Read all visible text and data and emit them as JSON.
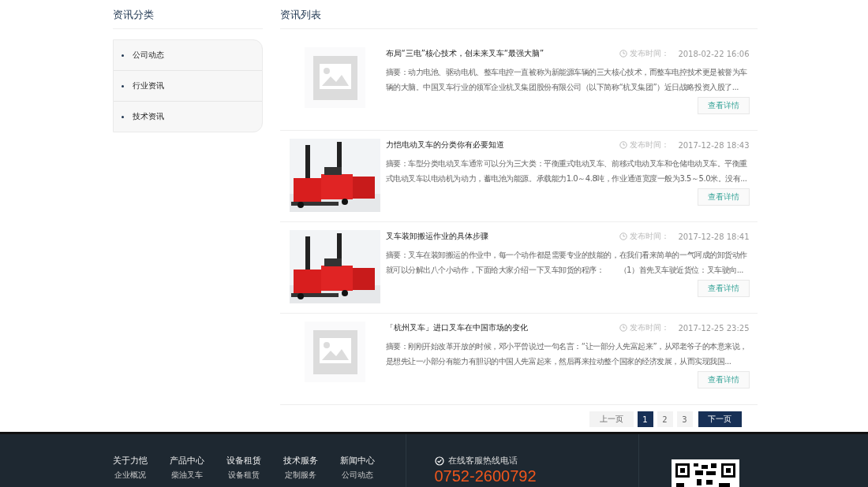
{
  "sidebar": {
    "title": "资讯分类",
    "items": [
      {
        "label": "公司动态"
      },
      {
        "label": "行业资讯"
      },
      {
        "label": "技术资讯"
      }
    ]
  },
  "list": {
    "title": "资讯列表",
    "items": [
      {
        "kind": "placeholder",
        "date_label": "发布时间：",
        "title": "布局“三电”核心技术，创未来叉车“最强大脑”",
        "date": "2018-02-22 16:06",
        "summary": "摘要：动力电池、驱动电机、整车电控一直被称为新能源车辆的三大核心技术，而整车电控技术更是被誉为车辆的大脑。中国叉车行业的领军企业杭叉集团股份有限公司（以下简称“杭叉集团”）近日战略投资入股了...",
        "button": "查看详情"
      },
      {
        "kind": "picture",
        "date_label": "发布时间：",
        "title": "力恺电动叉车的分类你有必要知道",
        "date": "2017-12-28 18:43",
        "summary": "摘要：车型分类电动叉车通常可以分为三大类：平衡重式电动叉车、前移式电动叉车和仓储电动叉车。平衡重式电动叉车以电动机为动力，蓄电池为能源。承载能力1.0～4.8吨，作业通道宽度一般为3.5～5.0米。没有...",
        "button": "查看详情"
      },
      {
        "kind": "picture",
        "date_label": "发布时间：",
        "title": "叉车装卸搬运作业的具体步骤",
        "date": "2017-12-28 18:41",
        "summary": "摘要：叉车在装卸搬运的作业中，每一个动作都是需要专业的技能的，在我们看来简单的一气呵成的卸货动作就可以分解出八个小动作，下面给大家介绍一下叉车卸货的程序：　　（1）首先叉车驶近货位：叉车驶向...",
        "button": "查看详情"
      },
      {
        "kind": "placeholder",
        "date_label": "发布时间：",
        "title": "「杭州叉车」进口叉车在中国市场的变化",
        "date": "2017-12-25 23:25",
        "summary": "摘要：刚刚开始改革开放的时候，邓小平曾说过一句名言：“让一部分人先富起来”，从邓老爷子的本意来说，是想先让一小部分有能力有胆识的中国人先富起来，然后再来拉动整个国家的经济发展，从而实现我国...",
        "button": "查看详情"
      }
    ]
  },
  "pagination": {
    "prev": "上一页",
    "pages": [
      {
        "label": "1",
        "selected": true
      },
      {
        "label": "2",
        "selected": false
      },
      {
        "label": "3",
        "selected": false
      }
    ],
    "next": "下一页"
  },
  "footer": {
    "columns": [
      {
        "title": "关于力恺",
        "links": [
          "企业概况"
        ]
      },
      {
        "title": "产品中心",
        "links": [
          "柴油叉车"
        ]
      },
      {
        "title": "设备租赁",
        "links": [
          "设备租赁"
        ]
      },
      {
        "title": "技术服务",
        "links": [
          "定制服务"
        ]
      },
      {
        "title": "新闻中心",
        "links": [
          "公司动态"
        ]
      }
    ],
    "hotline_label": "在线客服热线电话",
    "hotline": "0752-2600792"
  }
}
